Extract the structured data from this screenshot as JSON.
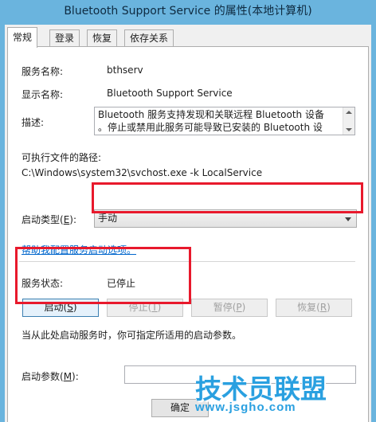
{
  "window": {
    "title": "Bluetooth Support Service 的属性(本地计算机)"
  },
  "tabs": [
    {
      "label": "常规",
      "active": true
    },
    {
      "label": "登录",
      "active": false
    },
    {
      "label": "恢复",
      "active": false
    },
    {
      "label": "依存关系",
      "active": false
    }
  ],
  "general": {
    "service_name_label": "服务名称:",
    "service_name_value": "bthserv",
    "display_name_label": "显示名称:",
    "display_name_value": "Bluetooth Support Service",
    "description_label": "描述:",
    "description_line1": "Bluetooth 服务支持发现和关联远程 Bluetooth 设备",
    "description_line2": "。停止或禁用此服务可能导致已安装的 Bluetooth 设",
    "exe_path_label": "可执行文件的路径:",
    "exe_path_value": "C:\\Windows\\system32\\svchost.exe -k LocalService",
    "startup_type_label": "启动类型(",
    "startup_type_key": "E",
    "startup_type_suffix": "):",
    "startup_type_value": "手动",
    "help_link": "帮助我配置服务启动选项。",
    "status_label": "服务状态:",
    "status_value": "已停止",
    "hint_text": "当从此处启动服务时，你可指定所适用的启动参数。",
    "params_label": "启动参数(",
    "params_key": "M",
    "params_suffix": "):",
    "params_value": ""
  },
  "buttons": {
    "start": {
      "label": "启动(",
      "key": "S",
      "suffix": ")"
    },
    "stop": {
      "label": "停止(",
      "key": "T",
      "suffix": ")"
    },
    "pause": {
      "label": "暂停(",
      "key": "P",
      "suffix": ")"
    },
    "resume": {
      "label": "恢复(",
      "key": "R",
      "suffix": ")"
    },
    "ok": "确定"
  },
  "watermark": {
    "text": "技术员联盟",
    "url": "www.jsgho.com"
  },
  "colors": {
    "accent": "#6ab4de",
    "highlight": "#e8192c",
    "link": "#0066cc",
    "watermark": "#2aa0e0"
  },
  "icons": [
    "chevron-down-icon",
    "scroll-up-icon",
    "scroll-down-icon"
  ]
}
